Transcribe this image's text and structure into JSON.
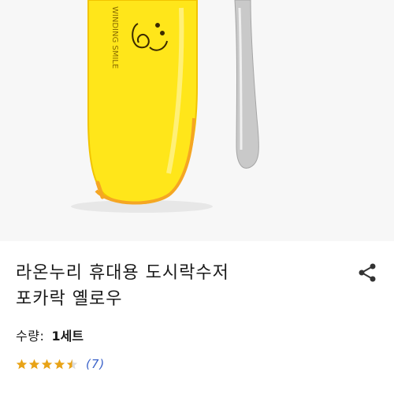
{
  "product": {
    "title_line1": "라온누리 휴대용 도시락수저",
    "title_line2": "포카락 옐로우",
    "image_alt": "yellow cutlery case with spoon",
    "case_brand_text": "WINDING SMILE",
    "case_color": "#ffe61a",
    "zipper_color": "#f5a623"
  },
  "quantity": {
    "label": "수량:",
    "value": "1세트"
  },
  "rating": {
    "stars": 4.5,
    "max": 5,
    "review_count": "(7)",
    "star_color": "#e8a317"
  },
  "actions": {
    "share_icon": "share-icon"
  }
}
